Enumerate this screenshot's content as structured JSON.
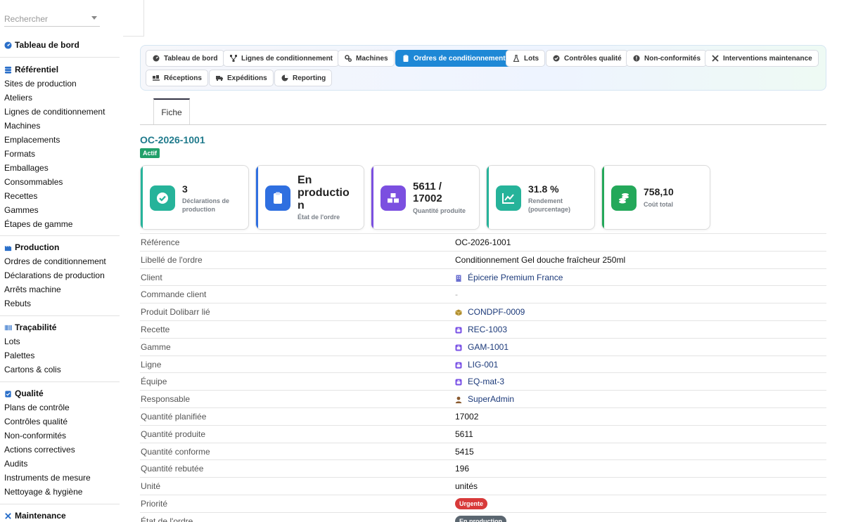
{
  "search": {
    "placeholder": "Rechercher"
  },
  "sidebar": {
    "dashboard": "Tableau de bord",
    "referentiel": {
      "title": "Référentiel",
      "items": [
        "Sites de production",
        "Ateliers",
        "Lignes de conditionnement",
        "Machines",
        "Emplacements",
        "Formats",
        "Emballages",
        "Consommables",
        "Recettes",
        "Gammes",
        "Étapes de gamme"
      ]
    },
    "production": {
      "title": "Production",
      "items": [
        "Ordres de conditionnement",
        "Déclarations de production",
        "Arrêts machine",
        "Rebuts"
      ]
    },
    "tracabilite": {
      "title": "Traçabilité",
      "items": [
        "Lots",
        "Palettes",
        "Cartons & colis"
      ]
    },
    "qualite": {
      "title": "Qualité",
      "items": [
        "Plans de contrôle",
        "Contrôles qualité",
        "Non-conformités",
        "Actions correctives",
        "Audits",
        "Instruments de mesure",
        "Nettoyage & hygiène"
      ]
    },
    "maintenance": {
      "title": "Maintenance"
    }
  },
  "tabs": [
    {
      "label": "Tableau de bord",
      "icon": "dashboard-icon"
    },
    {
      "label": "Lignes de conditionnement",
      "icon": "network-icon"
    },
    {
      "label": "Machines",
      "icon": "gears-icon"
    },
    {
      "label": "Ordres de conditionnement",
      "icon": "clipboard-icon",
      "active": true
    },
    {
      "label": "Lots",
      "icon": "flask-icon"
    },
    {
      "label": "Contrôles qualité",
      "icon": "check-circle-icon"
    },
    {
      "label": "Non-conformités",
      "icon": "exclamation-icon"
    },
    {
      "label": "Interventions maintenance",
      "icon": "tools-icon"
    },
    {
      "label": "Réceptions",
      "icon": "truck-loading-icon"
    },
    {
      "label": "Expéditions",
      "icon": "truck-icon"
    },
    {
      "label": "Reporting",
      "icon": "pie-chart-icon"
    }
  ],
  "sub_tab": "Fiche",
  "record": {
    "reference": "OC-2026-1001",
    "status": "Actif"
  },
  "kpis": [
    {
      "value": "3",
      "label": "Déclarations de production",
      "color": "#26b39a"
    },
    {
      "value": "En productio n",
      "label": "État de l'ordre",
      "color": "#2f6fe0"
    },
    {
      "value": "5611 / 17002",
      "label": "Quantité produite",
      "color": "#7b4fe0"
    },
    {
      "value": "31.8 %",
      "label": "Rendement (pourcentage)",
      "color": "#26b39a"
    },
    {
      "value": "758,10",
      "label": "Coût total",
      "color": "#24a85a"
    }
  ],
  "details": [
    {
      "key": "Référence",
      "value": "OC-2026-1001"
    },
    {
      "key": "Libellé de l'ordre",
      "value": "Conditionnement Gel douche fraîcheur 250ml"
    },
    {
      "key": "Client",
      "value": "Épicerie Premium France",
      "icon": "building-icon",
      "link": true
    },
    {
      "key": "Commande client",
      "value": "-"
    },
    {
      "key": "Produit Dolibarr lié",
      "value": "CONDPF-0009",
      "icon": "box-icon",
      "link": true
    },
    {
      "key": "Recette",
      "value": "REC-1003",
      "icon": "object-icon",
      "link": true
    },
    {
      "key": "Gamme",
      "value": "GAM-1001",
      "icon": "object-icon",
      "link": true
    },
    {
      "key": "Ligne",
      "value": "LIG-001",
      "icon": "object-icon",
      "link": true
    },
    {
      "key": "Équipe",
      "value": "EQ-mat-3",
      "icon": "object-icon",
      "link": true
    },
    {
      "key": "Responsable",
      "value": "SuperAdmin",
      "icon": "user-icon",
      "link": true
    },
    {
      "key": "Quantité planifiée",
      "value": "17002"
    },
    {
      "key": "Quantité produite",
      "value": "5611"
    },
    {
      "key": "Quantité conforme",
      "value": "5415"
    },
    {
      "key": "Quantité rebutée",
      "value": "196"
    },
    {
      "key": "Unité",
      "value": "unités"
    },
    {
      "key": "Priorité",
      "value": "Urgente",
      "pill": "#d83a3a"
    },
    {
      "key": "État de l'ordre",
      "value": "En production",
      "pill": "#5b6670"
    }
  ]
}
